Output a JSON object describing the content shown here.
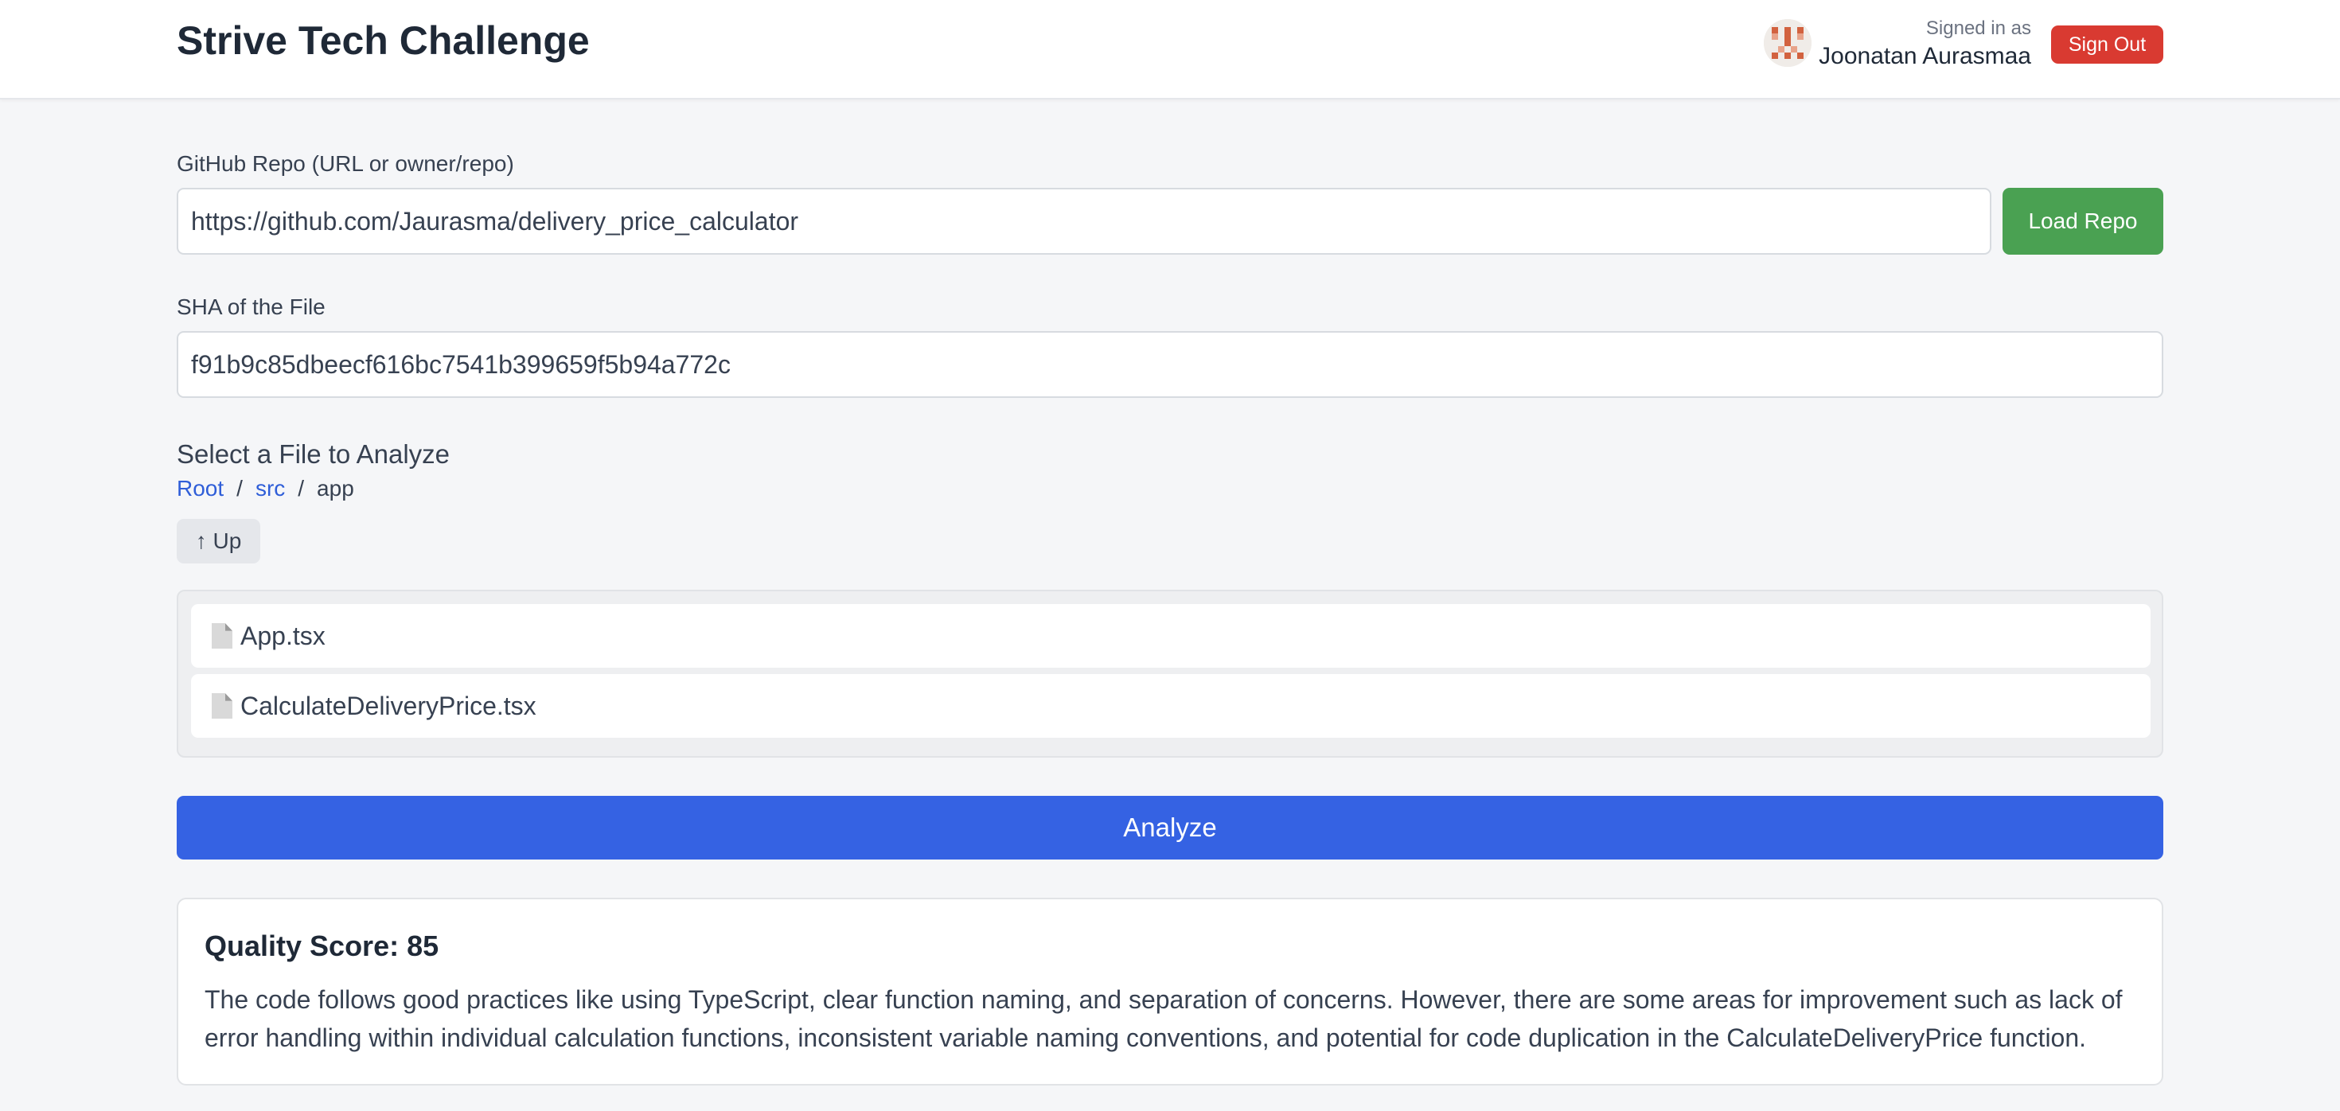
{
  "header": {
    "title": "Strive Tech Challenge",
    "signed_in_label": "Signed in as",
    "user_name": "Joonatan Aurasmaa",
    "sign_out_label": "Sign Out",
    "avatar_icon": "identicon-avatar"
  },
  "repo": {
    "label": "GitHub Repo (URL or owner/repo)",
    "value": "https://github.com/Jaurasma/delivery_price_calculator",
    "load_button": "Load Repo"
  },
  "sha": {
    "label": "SHA of the File",
    "value": "f91b9c85dbeecf616bc7541b399659f5b94a772c"
  },
  "file_browser": {
    "title": "Select a File to Analyze",
    "breadcrumb": {
      "root": "Root",
      "sep1": "/",
      "src": "src",
      "sep2": "/",
      "current": "app"
    },
    "up_button": "↑ Up",
    "files": [
      {
        "name": "App.tsx",
        "icon": "file-icon"
      },
      {
        "name": "CalculateDeliveryPrice.tsx",
        "icon": "file-icon"
      }
    ]
  },
  "analyze_button": "Analyze",
  "result": {
    "title": "Quality Score: 85",
    "text": "The code follows good practices like using TypeScript, clear function naming, and separation of concerns. However, there are some areas for improvement such as lack of error handling within individual calculation functions, inconsistent variable naming conventions, and potential for code duplication in the CalculateDeliveryPrice function."
  },
  "colors": {
    "sign_out": "#d93a31",
    "load_repo": "#4aa152",
    "analyze": "#3562e3",
    "link": "#2f5ed8"
  }
}
